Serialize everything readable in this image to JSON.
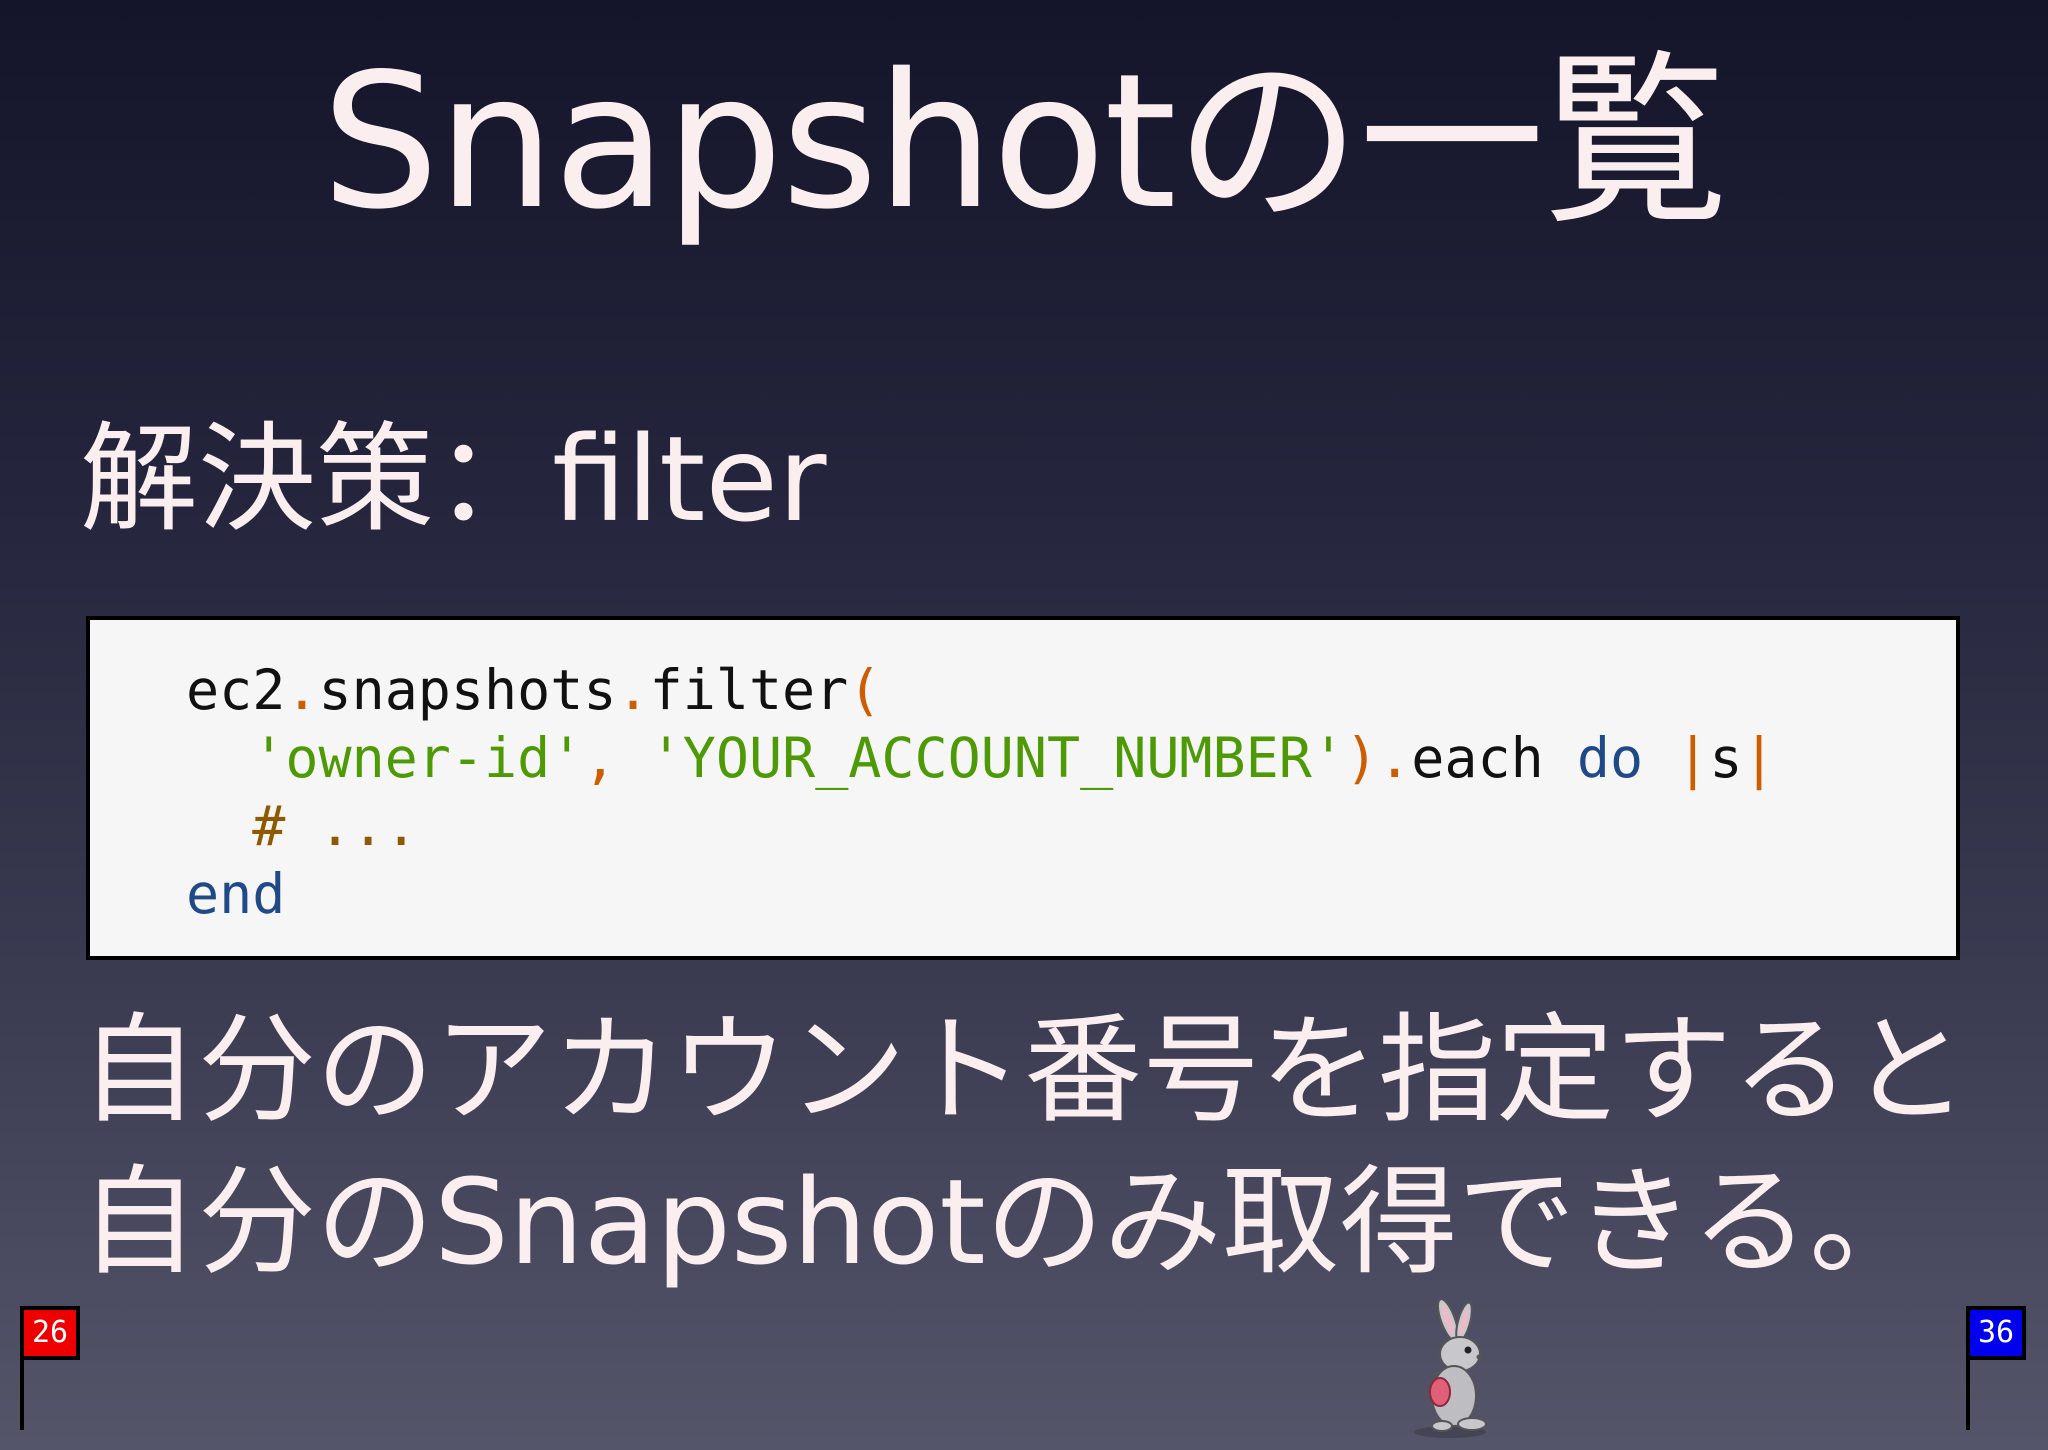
{
  "slide": {
    "title": "Snapshotの一覧",
    "heading": "解決策：filter",
    "code": {
      "line1": {
        "obj": "ec2",
        "dot1": ".",
        "method1": "snapshots",
        "dot2": ".",
        "method2": "filter",
        "paren_open": "("
      },
      "line2": {
        "indent": "  ",
        "str1": "'owner-id'",
        "comma": ",",
        "space": " ",
        "str2": "'YOUR_ACCOUNT_NUMBER'",
        "paren_close": ")",
        "dot3": ".",
        "method3": "each",
        "kw_do": "do",
        "pipe1": "|",
        "block_var": "s",
        "pipe2": "|"
      },
      "line3": {
        "indent": "  ",
        "comment": "# ..."
      },
      "line4": {
        "kw_end": "end"
      }
    },
    "body_lines": [
      "自分のアカウント番号を指定すると",
      "自分のSnapshotのみ取得できる。"
    ]
  },
  "footer": {
    "current_page": "26",
    "total_pages": "36",
    "start_flag_color": "#ee0000",
    "goal_flag_color": "#0000ee",
    "mascot_icon": "rabbit-icon"
  }
}
